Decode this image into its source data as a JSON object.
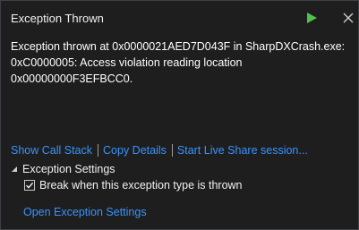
{
  "dialog": {
    "title": "Exception Thrown",
    "message_line1": "Exception thrown at 0x0000021AED7D043F in SharpDXCrash.exe:",
    "message_line2": "0xC0000005: Access violation reading location 0x00000000F3EFBCC0."
  },
  "links": {
    "call_stack": "Show Call Stack",
    "copy_details": "Copy Details",
    "live_share": "Start Live Share session..."
  },
  "exception_settings": {
    "header": "Exception Settings",
    "break_label": "Break when this exception type is thrown",
    "break_checked": true,
    "open_link": "Open Exception Settings"
  },
  "icons": {
    "continue": "play-icon",
    "close": "close-icon",
    "expander": "triangle-expanded-icon",
    "check": "checkmark-icon"
  },
  "colors": {
    "background": "#1e1e1e",
    "link": "#3794ff",
    "play_green": "#4ec24e",
    "border": "#3f3f46"
  }
}
